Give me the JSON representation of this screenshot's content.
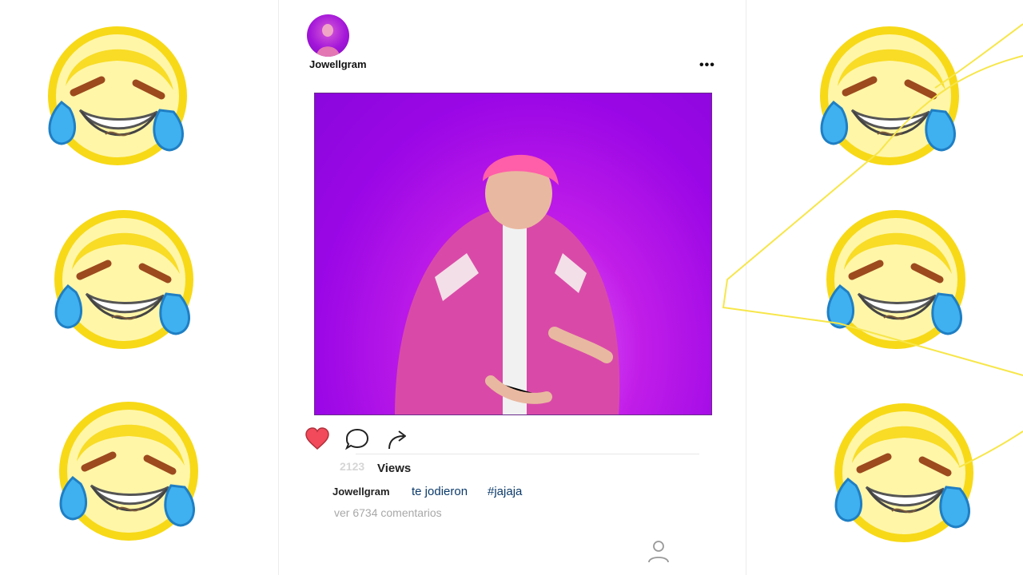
{
  "post": {
    "username": "Jowellgram",
    "more_label": "•••",
    "views_count": "2123",
    "views_label": "Views",
    "caption_user": "Jowellgram",
    "caption_text": "te jodieron",
    "hashtag": "#jajaja",
    "comments_link": "ver 6734 comentarios"
  },
  "icons": {
    "like": "heart-icon",
    "comment": "comment-bubble-icon",
    "share": "share-arrow-icon",
    "profile": "profile-icon",
    "more": "more-options-icon"
  },
  "decorations": {
    "emoji": "crying-laughing-emoji",
    "count_left": 3,
    "count_right": 3
  },
  "colors": {
    "like_red": "#f24a5a",
    "media_purple": "#9b07e6",
    "emoji_yellow": "#f7d917",
    "tear_blue": "#2f9be6",
    "caption_blue": "#0b3a6b"
  }
}
